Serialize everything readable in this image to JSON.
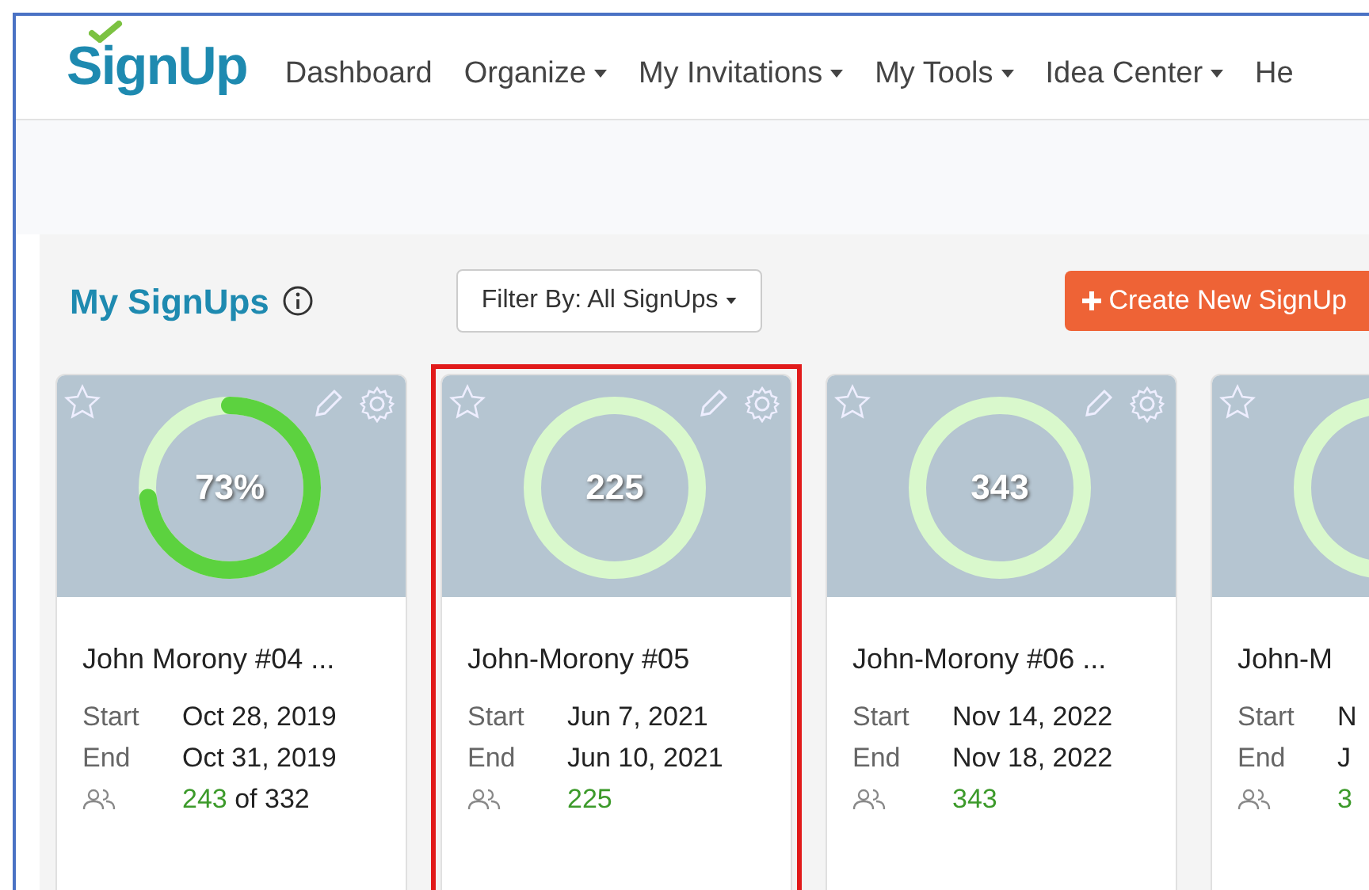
{
  "logo": {
    "text": "SignUp"
  },
  "nav": [
    {
      "label": "Dashboard",
      "dropdown": false
    },
    {
      "label": "Organize",
      "dropdown": true
    },
    {
      "label": "My Invitations",
      "dropdown": true
    },
    {
      "label": "My Tools",
      "dropdown": true
    },
    {
      "label": "Idea Center",
      "dropdown": true
    },
    {
      "label": "He",
      "dropdown": false
    }
  ],
  "section": {
    "title": "My SignUps",
    "filter": "Filter By: All SignUps",
    "create_button": "Create New SignUp"
  },
  "cards": [
    {
      "title": "John Morony #04 ...",
      "ring_text": "73%",
      "level": 0.73,
      "start_label": "Start",
      "start": "Oct 28, 2019",
      "end_label": "End",
      "end": "Oct 31, 2019",
      "filled": "243",
      "of_total": " of 332",
      "highlighted": false,
      "actions": true
    },
    {
      "title": "John-Morony #05",
      "ring_text": "225",
      "start_label": "Start",
      "start": "Jun 7, 2021",
      "end_label": "End",
      "end": "Jun 10, 2021",
      "filled": "225",
      "highlighted": true,
      "actions": true
    },
    {
      "title": "John-Morony #06 ...",
      "ring_text": "343",
      "start_label": "Start",
      "start": "Nov 14, 2022",
      "end_label": "End",
      "end": "Nov 18, 2022",
      "filled": "343",
      "highlighted": false,
      "actions": true
    },
    {
      "title": "John-M",
      "start_label": "Start",
      "start": "N",
      "end_label": "End",
      "end": "J",
      "filled": "3",
      "highlighted": false,
      "actions": false
    }
  ]
}
